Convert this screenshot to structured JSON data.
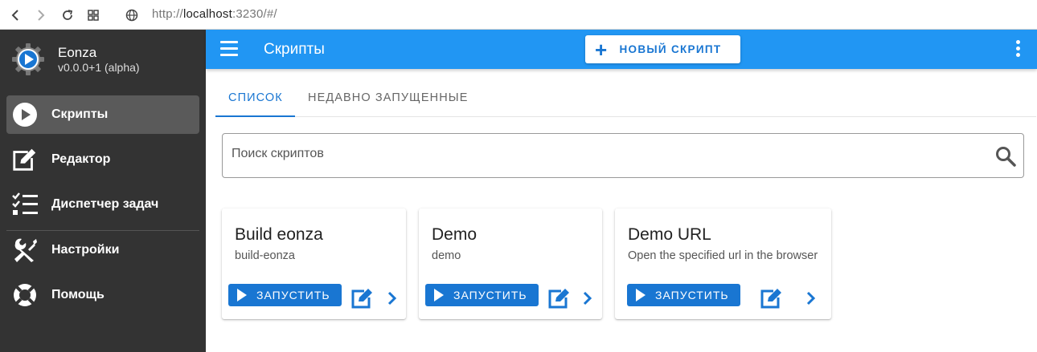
{
  "browser": {
    "url_prefix": "http://",
    "url_host": "localhost",
    "url_rest": ":3230/#/"
  },
  "sidebar": {
    "app_name": "Eonza",
    "version": "v0.0.0+1 (alpha)",
    "items": [
      {
        "label": "Скрипты",
        "icon": "play-circle-icon"
      },
      {
        "label": "Редактор",
        "icon": "edit-square-icon"
      },
      {
        "label": "Диспетчер задач",
        "icon": "task-list-icon"
      },
      {
        "label": "Настройки",
        "icon": "tools-icon"
      },
      {
        "label": "Помощь",
        "icon": "lifebuoy-icon"
      }
    ]
  },
  "appbar": {
    "title": "Скрипты",
    "new_script_label": "НОВЫЙ СКРИПТ"
  },
  "tabs": [
    "СПИСОК",
    "НЕДАВНО ЗАПУЩЕННЫЕ"
  ],
  "search": {
    "placeholder": "Поиск скриптов"
  },
  "scripts": [
    {
      "title": "Build eonza",
      "description": "build-eonza",
      "run_label": "ЗАПУСТИТЬ"
    },
    {
      "title": "Demo",
      "description": "demo",
      "run_label": "ЗАПУСТИТЬ"
    },
    {
      "title": "Demo URL",
      "description": "Open the specified url in the browser",
      "run_label": "ЗАПУСТИТЬ"
    }
  ],
  "colors": {
    "primary": "#2196f3",
    "accent": "#1976d2",
    "sidebar": "#333333"
  }
}
